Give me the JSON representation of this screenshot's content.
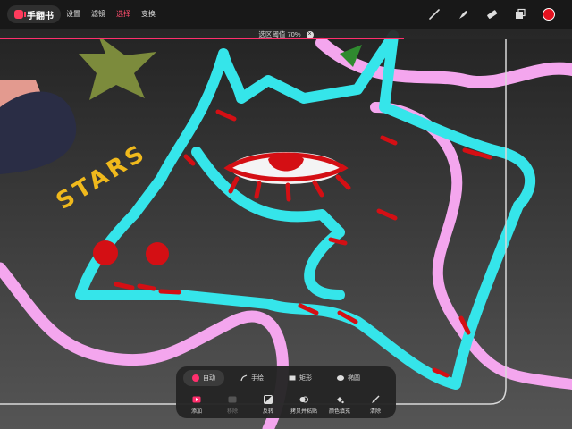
{
  "app": {
    "name": "手翻书"
  },
  "menu": [
    "设置",
    "滤镜",
    "选择",
    "变换"
  ],
  "tools": {
    "icons": [
      "brush-icon",
      "smudge-icon",
      "eraser-icon",
      "layers-icon"
    ],
    "color": "#e3121f"
  },
  "threshold": {
    "label": "选区阈值",
    "value": "70%",
    "level": 0.7
  },
  "selection_panel": {
    "modes": [
      {
        "label": "自动",
        "icon": "red-dot-icon",
        "active": true
      },
      {
        "label": "手绘",
        "icon": "freehand-icon"
      },
      {
        "label": "矩形",
        "icon": "rectangle-icon"
      },
      {
        "label": "椭圆",
        "icon": "ellipse-icon"
      }
    ],
    "actions": [
      {
        "label": "添加",
        "icon": "add-selection-icon"
      },
      {
        "label": "移除",
        "icon": "remove-selection-icon",
        "disabled": true
      },
      {
        "label": "反转",
        "icon": "invert-icon"
      },
      {
        "label": "拷贝并粘贴",
        "icon": "copy-paste-icon"
      },
      {
        "label": "颜色填充",
        "icon": "fill-icon"
      },
      {
        "label": "清除",
        "icon": "clear-icon"
      }
    ]
  },
  "canvas": {
    "text": "STARS"
  },
  "colors": {
    "accent": "#ff2f6d",
    "cyan": "#35e5ea",
    "pink": "#f4a6ee",
    "red": "#d40f14",
    "yellow": "#f0b91c",
    "olive": "#7c8b3c"
  }
}
